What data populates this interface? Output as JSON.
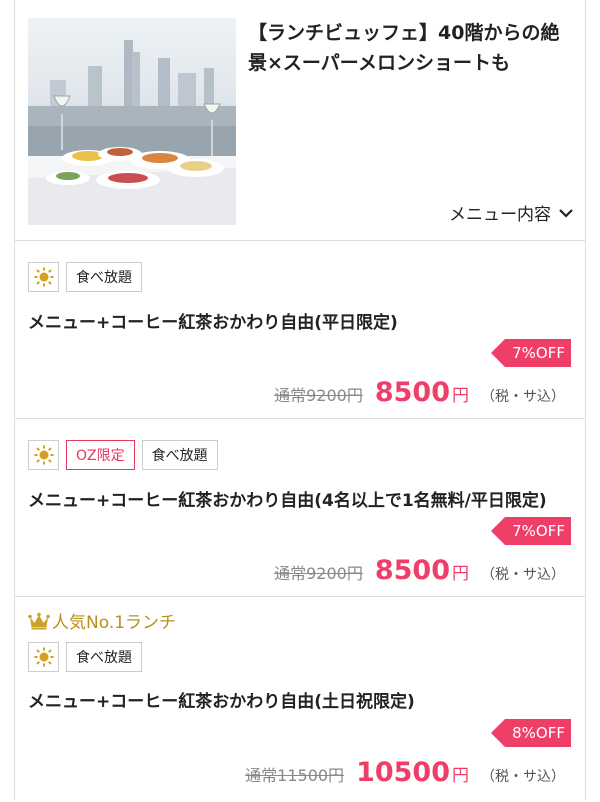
{
  "header": {
    "title": "【ランチビュッフェ】40階からの絶景×スーパーメロンショートも",
    "menu_toggle": "メニュー内容",
    "image_alt": "高層階の窓際に並ぶビュッフェ料理とワイングラス"
  },
  "plans": [
    {
      "tags": [
        "sun-icon",
        "食べ放題"
      ],
      "name": "メニュー+コーヒー紅茶おかわり自由(平日限定)",
      "discount": "7%OFF",
      "regular_price": "通常9200円",
      "sale_price": "8500",
      "yen": "円",
      "tax_note": "（税・サ込）"
    },
    {
      "tags": [
        "sun-icon",
        "OZ限定",
        "食べ放題"
      ],
      "name": "メニュー+コーヒー紅茶おかわり自由(4名以上で1名無料/平日限定)",
      "discount": "7%OFF",
      "regular_price": "通常9200円",
      "sale_price": "8500",
      "yen": "円",
      "tax_note": "（税・サ込）"
    },
    {
      "badge": "人気No.1ランチ",
      "tags": [
        "sun-icon",
        "食べ放題"
      ],
      "name": "メニュー+コーヒー紅茶おかわり自由(土日祝限定)",
      "discount": "8%OFF",
      "regular_price": "通常11500円",
      "sale_price": "10500",
      "yen": "円",
      "tax_note": "（税・サ込）"
    }
  ],
  "colors": {
    "accent": "#ef3f69",
    "gold": "#b8901c",
    "border": "#dddddd"
  }
}
